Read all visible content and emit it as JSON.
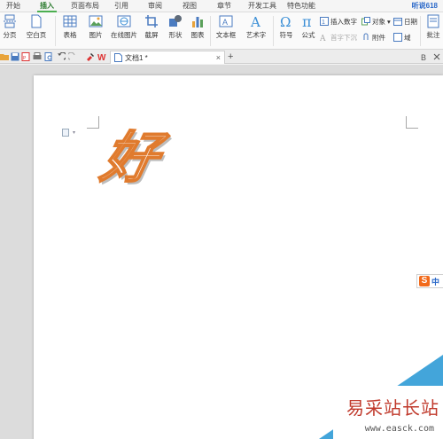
{
  "menu": {
    "tabs": [
      "开始",
      "插入",
      "页面布局",
      "引用",
      "审阅",
      "视图",
      "章节",
      "开发工具",
      "特色功能"
    ],
    "active": "插入",
    "user": "听说618"
  },
  "ribbon": {
    "page_break": "分页",
    "blank_page": "空白页",
    "table": "表格",
    "picture": "图片",
    "online_picture": "在线图片",
    "screenshot": "截屏",
    "shape": "形状",
    "chart": "图表",
    "textbox": "文本框",
    "wordart": "艺术字",
    "symbol": "符号",
    "formula": "公式",
    "insert_number": "插入数字",
    "object": "对象",
    "date": "日期",
    "drop_cap": "首字下沉",
    "attachment": "附件",
    "field": "域",
    "comment": "批注"
  },
  "document": {
    "tab_title": "文档1 *",
    "wordart_text": "好"
  },
  "ime": {
    "logo": "S",
    "mode": "中"
  },
  "watermark": {
    "title": "易采站长站",
    "url": "www.easck.com"
  },
  "colors": {
    "accent_green": "#4caf50",
    "wordart_outline": "#e07b2e",
    "ime_orange": "#f26a1b",
    "watermark_red": "#c0392b",
    "watermark_blue": "#2f9bd6"
  }
}
